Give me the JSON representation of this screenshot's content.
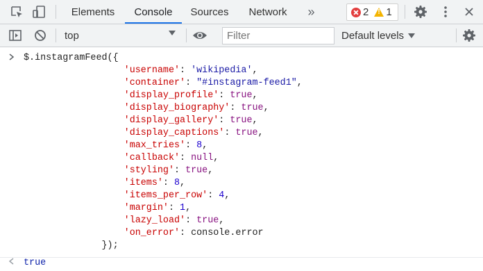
{
  "tabbar": {
    "icons": {
      "inspect": "inspect-element-icon",
      "device": "device-toolbar-icon",
      "settings": "gear-icon",
      "menu": "kebab-menu-icon"
    },
    "tabs": [
      {
        "label": "Elements",
        "active": false
      },
      {
        "label": "Console",
        "active": true
      },
      {
        "label": "Sources",
        "active": false
      },
      {
        "label": "Network",
        "active": false
      }
    ],
    "more_tabs": "»",
    "error_count": "2",
    "warning_count": "1"
  },
  "toolbar": {
    "context": "top",
    "filter_placeholder": "Filter",
    "levels_label": "Default levels"
  },
  "console": {
    "input_prompt": ">",
    "result_prompt": "<",
    "lines": [
      [
        {
          "t": "p",
          "v": "$.instagramFeed({"
        }
      ],
      [
        {
          "t": "p",
          "v": "                  "
        },
        {
          "t": "k",
          "v": "'username'"
        },
        {
          "t": "p",
          "v": ": "
        },
        {
          "t": "s",
          "v": "'wikipedia'"
        },
        {
          "t": "p",
          "v": ","
        }
      ],
      [
        {
          "t": "p",
          "v": "                  "
        },
        {
          "t": "k",
          "v": "'container'"
        },
        {
          "t": "p",
          "v": ": "
        },
        {
          "t": "s",
          "v": "\"#instagram-feed1\""
        },
        {
          "t": "p",
          "v": ","
        }
      ],
      [
        {
          "t": "p",
          "v": "                  "
        },
        {
          "t": "k",
          "v": "'display_profile'"
        },
        {
          "t": "p",
          "v": ": "
        },
        {
          "t": "b",
          "v": "true"
        },
        {
          "t": "p",
          "v": ","
        }
      ],
      [
        {
          "t": "p",
          "v": "                  "
        },
        {
          "t": "k",
          "v": "'display_biography'"
        },
        {
          "t": "p",
          "v": ": "
        },
        {
          "t": "b",
          "v": "true"
        },
        {
          "t": "p",
          "v": ","
        }
      ],
      [
        {
          "t": "p",
          "v": "                  "
        },
        {
          "t": "k",
          "v": "'display_gallery'"
        },
        {
          "t": "p",
          "v": ": "
        },
        {
          "t": "b",
          "v": "true"
        },
        {
          "t": "p",
          "v": ","
        }
      ],
      [
        {
          "t": "p",
          "v": "                  "
        },
        {
          "t": "k",
          "v": "'display_captions'"
        },
        {
          "t": "p",
          "v": ": "
        },
        {
          "t": "b",
          "v": "true"
        },
        {
          "t": "p",
          "v": ","
        }
      ],
      [
        {
          "t": "p",
          "v": "                  "
        },
        {
          "t": "k",
          "v": "'max_tries'"
        },
        {
          "t": "p",
          "v": ": "
        },
        {
          "t": "n",
          "v": "8"
        },
        {
          "t": "p",
          "v": ","
        }
      ],
      [
        {
          "t": "p",
          "v": "                  "
        },
        {
          "t": "k",
          "v": "'callback'"
        },
        {
          "t": "p",
          "v": ": "
        },
        {
          "t": "b",
          "v": "null"
        },
        {
          "t": "p",
          "v": ","
        }
      ],
      [
        {
          "t": "p",
          "v": "                  "
        },
        {
          "t": "k",
          "v": "'styling'"
        },
        {
          "t": "p",
          "v": ": "
        },
        {
          "t": "b",
          "v": "true"
        },
        {
          "t": "p",
          "v": ","
        }
      ],
      [
        {
          "t": "p",
          "v": "                  "
        },
        {
          "t": "k",
          "v": "'items'"
        },
        {
          "t": "p",
          "v": ": "
        },
        {
          "t": "n",
          "v": "8"
        },
        {
          "t": "p",
          "v": ","
        }
      ],
      [
        {
          "t": "p",
          "v": "                  "
        },
        {
          "t": "k",
          "v": "'items_per_row'"
        },
        {
          "t": "p",
          "v": ": "
        },
        {
          "t": "n",
          "v": "4"
        },
        {
          "t": "p",
          "v": ","
        }
      ],
      [
        {
          "t": "p",
          "v": "                  "
        },
        {
          "t": "k",
          "v": "'margin'"
        },
        {
          "t": "p",
          "v": ": "
        },
        {
          "t": "n",
          "v": "1"
        },
        {
          "t": "p",
          "v": ","
        }
      ],
      [
        {
          "t": "p",
          "v": "                  "
        },
        {
          "t": "k",
          "v": "'lazy_load'"
        },
        {
          "t": "p",
          "v": ": "
        },
        {
          "t": "b",
          "v": "true"
        },
        {
          "t": "p",
          "v": ","
        }
      ],
      [
        {
          "t": "p",
          "v": "                  "
        },
        {
          "t": "k",
          "v": "'on_error'"
        },
        {
          "t": "p",
          "v": ": "
        },
        {
          "t": "p",
          "v": "console.error"
        }
      ],
      [
        {
          "t": "p",
          "v": "              });"
        }
      ]
    ],
    "result": "true"
  },
  "colors": {
    "key": "#c80000",
    "string": "#1a1aa6",
    "boolean": "#881280",
    "number": "#1c00cf",
    "result": "#0d22aa",
    "active_tab_underline": "#1a73e8",
    "error": "#e33f3f",
    "warning": "#f4b400"
  }
}
